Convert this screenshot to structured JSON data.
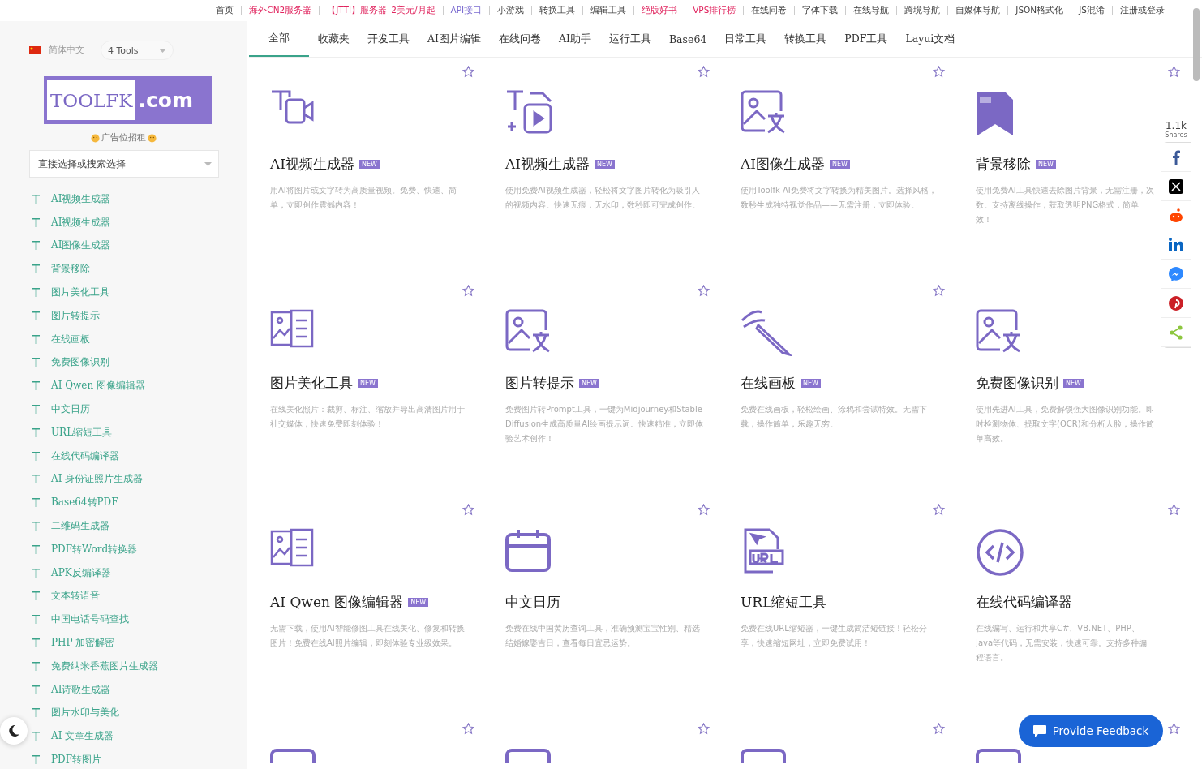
{
  "top_nav": [
    {
      "label": "首页",
      "kind": "plain"
    },
    {
      "label": "海外CN2服务器",
      "kind": "promo"
    },
    {
      "label": "【JTTI】服务器_2美元/月起",
      "kind": "promo"
    },
    {
      "label": "API接口",
      "kind": "api"
    },
    {
      "label": "小游戏",
      "kind": "plain"
    },
    {
      "label": "转换工具",
      "kind": "plain"
    },
    {
      "label": "编辑工具",
      "kind": "plain"
    },
    {
      "label": "绝版好书",
      "kind": "promo"
    },
    {
      "label": "VPS排行榜",
      "kind": "promo"
    },
    {
      "label": "在线问卷",
      "kind": "plain"
    },
    {
      "label": "字体下载",
      "kind": "plain"
    },
    {
      "label": "在线导航",
      "kind": "plain"
    },
    {
      "label": "跨境导航",
      "kind": "plain"
    },
    {
      "label": "自媒体导航",
      "kind": "plain"
    },
    {
      "label": "JSON格式化",
      "kind": "plain"
    },
    {
      "label": "JS混淆",
      "kind": "plain"
    },
    {
      "label": "注册或登录",
      "kind": "plain"
    }
  ],
  "sidebar": {
    "language": "简体中文",
    "tools_select": "4 Tools",
    "logo_left": "TOOLFK",
    "logo_right": ".com",
    "ad": "广告位招租",
    "search": {
      "placeholder": "直接选择或搜索选择"
    },
    "items": [
      "AI视频生成器",
      "AI视频生成器",
      "AI图像生成器",
      "背景移除",
      "图片美化工具",
      "图片转提示",
      "在线画板",
      "免费图像识别",
      "AI Qwen 图像编辑器",
      "中文日历",
      "URL缩短工具",
      "在线代码编译器",
      "AI 身份证照片生成器",
      "Base64转PDF",
      "二维码生成器",
      "PDF转Word转换器",
      "APK反编译器",
      "文本转语音",
      "中国电话号码查找",
      "PHP 加密解密",
      "免费纳米香蕉图片生成器",
      "AI诗歌生成器",
      "图片水印与美化",
      "AI 文章生成器",
      "PDF转图片"
    ]
  },
  "tabs": [
    {
      "label": "全部",
      "selected": true
    },
    {
      "label": "收藏夹",
      "selected": false
    },
    {
      "label": "开发工具",
      "selected": false
    },
    {
      "label": "AI图片编辑",
      "selected": false
    },
    {
      "label": "在线问卷",
      "selected": false
    },
    {
      "label": "AI助手",
      "selected": false
    },
    {
      "label": "运行工具",
      "selected": false
    },
    {
      "label": "Base64",
      "selected": false
    },
    {
      "label": "日常工具",
      "selected": false
    },
    {
      "label": "转换工具",
      "selected": false
    },
    {
      "label": "PDF工具",
      "selected": false
    },
    {
      "label": "Layui文档",
      "selected": false
    }
  ],
  "cards": [
    {
      "kind": "video",
      "star_visible": true,
      "title": "AI视频生成器",
      "badge": "NEW",
      "description": "用AI将图片或文字转为高质量视频。免费、快速、简单，立即创作震撼内容！"
    },
    {
      "kind": "video-text",
      "star_visible": true,
      "title": "AI视频生成器",
      "badge": "NEW",
      "description": "使用免费AI视频生成器，轻松将文字图片转化为吸引人的视频内容。快速无痕，无水印，数秒即可完成创作。"
    },
    {
      "kind": "image-text",
      "star_visible": true,
      "title": "AI图像生成器",
      "badge": "NEW",
      "description": "使用Toolfk AI免费将文字转换为精美图片。选择风格，数秒生成独特视觉作品——无需注册，立即体验。"
    },
    {
      "kind": "bookmark",
      "star_visible": true,
      "title": "背景移除",
      "badge": "NEW",
      "description": "使用免费AI工具快速去除图片背景，无需注册，次数。支持离线操作，获取透明PNG格式，简单效！"
    },
    {
      "kind": "gallery",
      "star_visible": true,
      "title": "图片美化工具",
      "badge": "NEW",
      "description": "在线美化照片：裁剪、标注、缩放并导出高清图片用于社交媒体，快速免费即刻体验！"
    },
    {
      "kind": "image-text",
      "star_visible": true,
      "title": "图片转提示",
      "badge": "NEW",
      "description": "免费图片转Prompt工具，一键为Midjourney和Stable Diffusion生成高质量AI绘画提示词。快速精准，立即体验艺术创作！"
    },
    {
      "kind": "pencil",
      "star_visible": true,
      "title": "在线画板",
      "badge": "NEW",
      "description": "免费在线画板，轻松绘画、涂鸦和尝试特效。无需下载，操作简单，乐趣无穷。"
    },
    {
      "kind": "image-text",
      "star_visible": false,
      "title": "免费图像识别",
      "badge": "NEW",
      "description": "使用先进AI工具，免费解锁强大图像识别功能。即时检测物体、提取文字(OCR)和分析人脸，操作简单高效。"
    },
    {
      "kind": "gallery",
      "star_visible": true,
      "title": "AI Qwen 图像编辑器",
      "badge": "NEW",
      "description": "无需下载，使用AI智能修图工具在线美化、修复和转换图片！免费在线AI照片编辑，即刻体验专业级效果。"
    },
    {
      "kind": "calendar",
      "star_visible": true,
      "title": "中文日历",
      "description": "免费在线中国黄历查询工具，准确预测宝宝性别、精选结婚嫁娶吉日，查看每日宜忌运势。"
    },
    {
      "kind": "url",
      "star_visible": true,
      "title": "URL缩短工具",
      "description": "免费在线URL缩短器，一键生成简洁短链接！轻松分享，快速缩短网址，立即免费试用！"
    },
    {
      "kind": "code",
      "star_visible": true,
      "title": "在线代码编译器",
      "description": "在线编写、运行和共享C#、VB.NET、PHP、Java等代码，无需安装，快速可靠。支持多种编程语言。"
    },
    {
      "kind": "partial",
      "star_visible": true
    },
    {
      "kind": "partial",
      "star_visible": true
    },
    {
      "kind": "partial",
      "star_visible": true
    },
    {
      "kind": "partial",
      "star_visible": true
    }
  ],
  "share": {
    "count": "1.1k",
    "label": "Shares"
  },
  "feedback_button": "Provide Feedback"
}
